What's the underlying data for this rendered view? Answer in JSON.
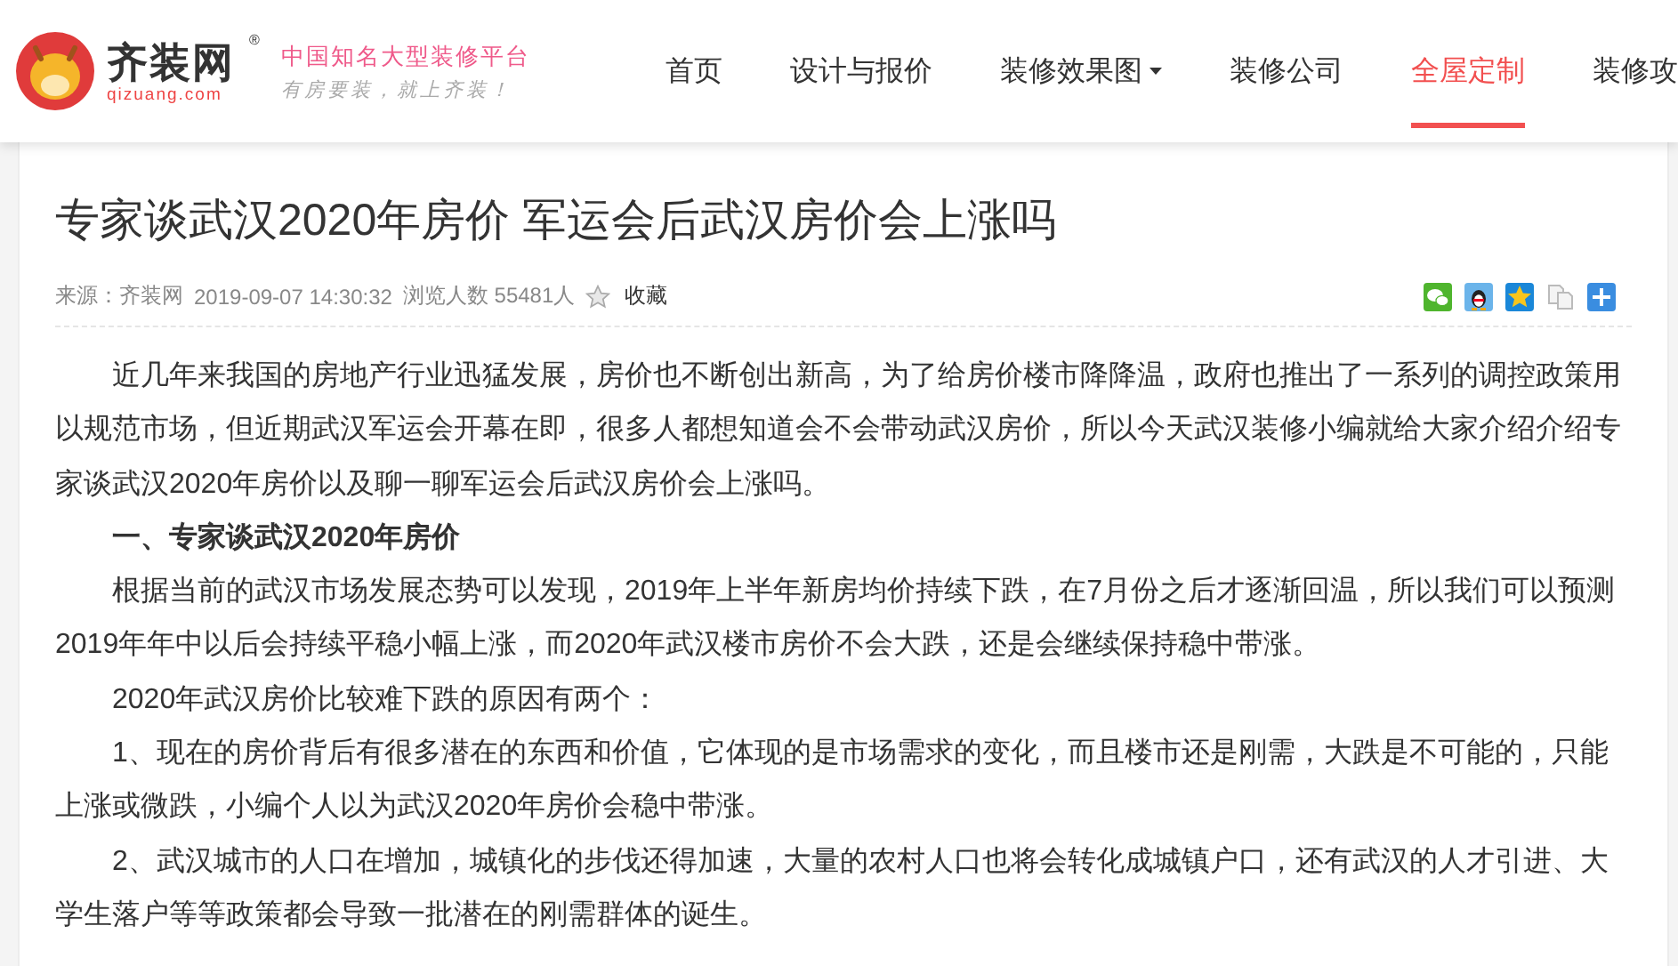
{
  "header": {
    "logo": {
      "name": "齐装网",
      "registered": "®",
      "domain": "qizuang.com"
    },
    "slogan": {
      "main": "中国知名大型装修平台",
      "sub": "有房要装，就上齐装！"
    },
    "nav": [
      {
        "label": "首页",
        "selected": false,
        "dropdown": false
      },
      {
        "label": "设计与报价",
        "selected": false,
        "dropdown": false
      },
      {
        "label": "装修效果图",
        "selected": false,
        "dropdown": true
      },
      {
        "label": "装修公司",
        "selected": false,
        "dropdown": false
      },
      {
        "label": "全屋定制",
        "selected": true,
        "dropdown": false
      },
      {
        "label": "装修攻",
        "selected": false,
        "dropdown": false
      }
    ]
  },
  "article": {
    "title": "专家谈武汉2020年房价 军运会后武汉房价会上涨吗",
    "meta": {
      "source": "来源：齐装网",
      "datetime": "2019-09-07 14:30:32",
      "views": "浏览人数 55481人",
      "favorite": "收藏"
    },
    "share": [
      {
        "kind": "wechat"
      },
      {
        "kind": "qq"
      },
      {
        "kind": "qzone"
      },
      {
        "kind": "copy"
      },
      {
        "kind": "more"
      }
    ],
    "paragraphs": [
      {
        "kind": "text",
        "text": "近几年来我国的房地产行业迅猛发展，房价也不断创出新高，为了给房价楼市降降温，政府也推出了一系列的调控政策用以规范市场，但近期武汉军运会开幕在即，很多人都想知道会不会带动武汉房价，所以今天武汉装修小编就给大家介绍介绍专家谈武汉2020年房价以及聊一聊军运会后武汉房价会上涨吗。"
      },
      {
        "kind": "heading",
        "text": "一、专家谈武汉2020年房价"
      },
      {
        "kind": "text",
        "text": "根据当前的武汉市场发展态势可以发现，2019年上半年新房均价持续下跌，在7月份之后才逐渐回温，所以我们可以预测2019年年中以后会持续平稳小幅上涨，而2020年武汉楼市房价不会大跌，还是会继续保持稳中带涨。"
      },
      {
        "kind": "text",
        "text": "2020年武汉房价比较难下跌的原因有两个："
      },
      {
        "kind": "text",
        "text": "1、现在的房价背后有很多潜在的东西和价值，它体现的是市场需求的变化，而且楼市还是刚需，大跌是不可能的，只能上涨或微跌，小编个人以为武汉2020年房价会稳中带涨。"
      },
      {
        "kind": "text",
        "text": "2、武汉城市的人口在增加，城镇化的步伐还得加速，大量的农村人口也将会转化成城镇户口，还有武汉的人才引进、大学生落户等等政策都会导致一批潜在的刚需群体的诞生。"
      }
    ]
  }
}
